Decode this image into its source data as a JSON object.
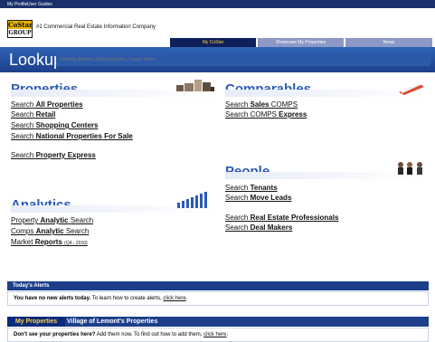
{
  "topnav": {
    "my_profile": "My Profile",
    "user_guides": "User Guides"
  },
  "brand": {
    "logo_line1": "CoStar",
    "logo_line2": "GROUP",
    "tagline": "#1 Commercial Real Estate Information Company"
  },
  "tabs": [
    {
      "label": "My CoStar",
      "active": true
    },
    {
      "label": "Showcase My Properties",
      "active": false
    },
    {
      "label": "News",
      "active": false
    }
  ],
  "lookup": {
    "title": "Lookup",
    "placeholder": "Property Address, Building Name, Owner Name"
  },
  "sections": {
    "properties": {
      "title": "Properties",
      "links": [
        {
          "prefix": "Search",
          "bold": "All Properties"
        },
        {
          "prefix": "Search",
          "bold": "Retail"
        },
        {
          "prefix": "Search",
          "bold": "Shopping Centers"
        },
        {
          "prefix": "Search",
          "bold": "National Properties For Sale"
        },
        {
          "prefix": "Search",
          "bold": "Property Express"
        }
      ]
    },
    "comparables": {
      "title": "Comparables",
      "links": [
        {
          "prefix": "Search",
          "bold": "Sales",
          "suffix": "COMPS"
        },
        {
          "prefix": "Search",
          "mid": "COMPS",
          "bold": "Express"
        }
      ]
    },
    "analytics": {
      "title": "Analytics",
      "links": [
        {
          "prefix": "Property",
          "bold": "Analytic",
          "suffix": "Search"
        },
        {
          "prefix": "Comps",
          "bold": "Analytic",
          "suffix": "Search"
        },
        {
          "prefix": "Market",
          "bold": "Reports",
          "small": "(Q4 - 2010)"
        }
      ]
    },
    "people": {
      "title": "People",
      "links": [
        {
          "prefix": "Search",
          "bold": "Tenants"
        },
        {
          "prefix": "Search",
          "bold": "Move Leads"
        },
        {
          "prefix": "Search",
          "bold": "Real Estate Professionals"
        },
        {
          "prefix": "Search",
          "bold": "Deal Makers"
        }
      ]
    }
  },
  "alerts": {
    "header": "Today's Alerts",
    "bold": "You have no new alerts today.",
    "text": "To learn how to create alerts,",
    "link": "click here"
  },
  "my_properties": {
    "tab1": "My Properties",
    "tab2": "Village of Lemont's Properties",
    "bold": "Don't see your properties here?",
    "text": "Add them now. To find out how to add them,",
    "link": "click here"
  }
}
